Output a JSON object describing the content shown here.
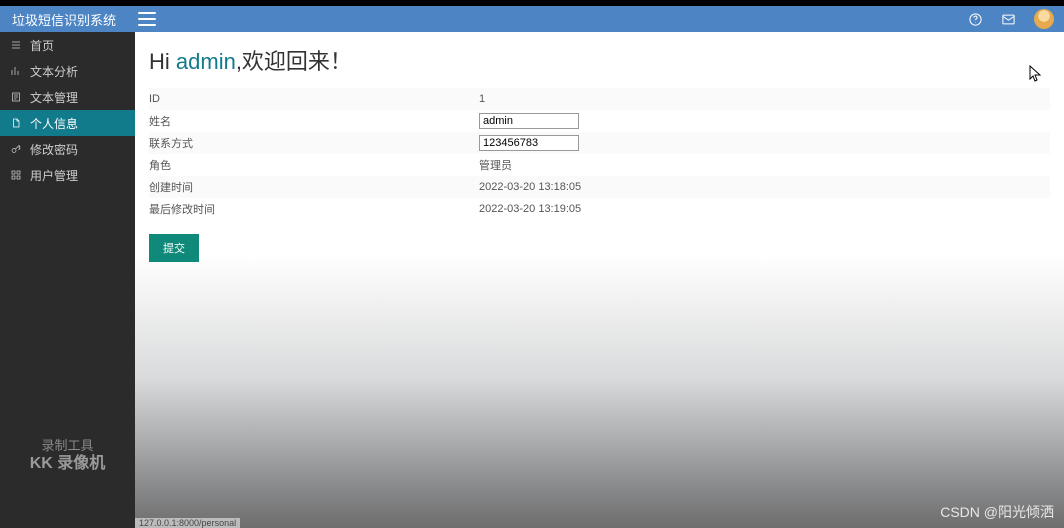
{
  "brand": "垃圾短信识别系统",
  "sidebar": {
    "items": [
      {
        "label": "首页"
      },
      {
        "label": "文本分析"
      },
      {
        "label": "文本管理"
      },
      {
        "label": "个人信息"
      },
      {
        "label": "修改密码"
      },
      {
        "label": "用户管理"
      }
    ]
  },
  "greet": {
    "prefix": "Hi ",
    "user": "admin",
    "suffix": ",欢迎回来！"
  },
  "form": {
    "rows": [
      {
        "label": "ID",
        "value": "1",
        "type": "text"
      },
      {
        "label": "姓名",
        "value": "admin",
        "type": "input"
      },
      {
        "label": "联系方式",
        "value": "123456783",
        "type": "input"
      },
      {
        "label": "角色",
        "value": "管理员",
        "type": "text"
      },
      {
        "label": "创建时间",
        "value": "2022-03-20 13:18:05",
        "type": "text"
      },
      {
        "label": "最后修改时间",
        "value": "2022-03-20 13:19:05",
        "type": "text"
      }
    ],
    "submit": "提交"
  },
  "watermark": {
    "line1": "录制工具",
    "line2": "KK 录像机"
  },
  "csdn": "CSDN @阳光倾洒",
  "status": "127.0.0.1:8000/personal"
}
